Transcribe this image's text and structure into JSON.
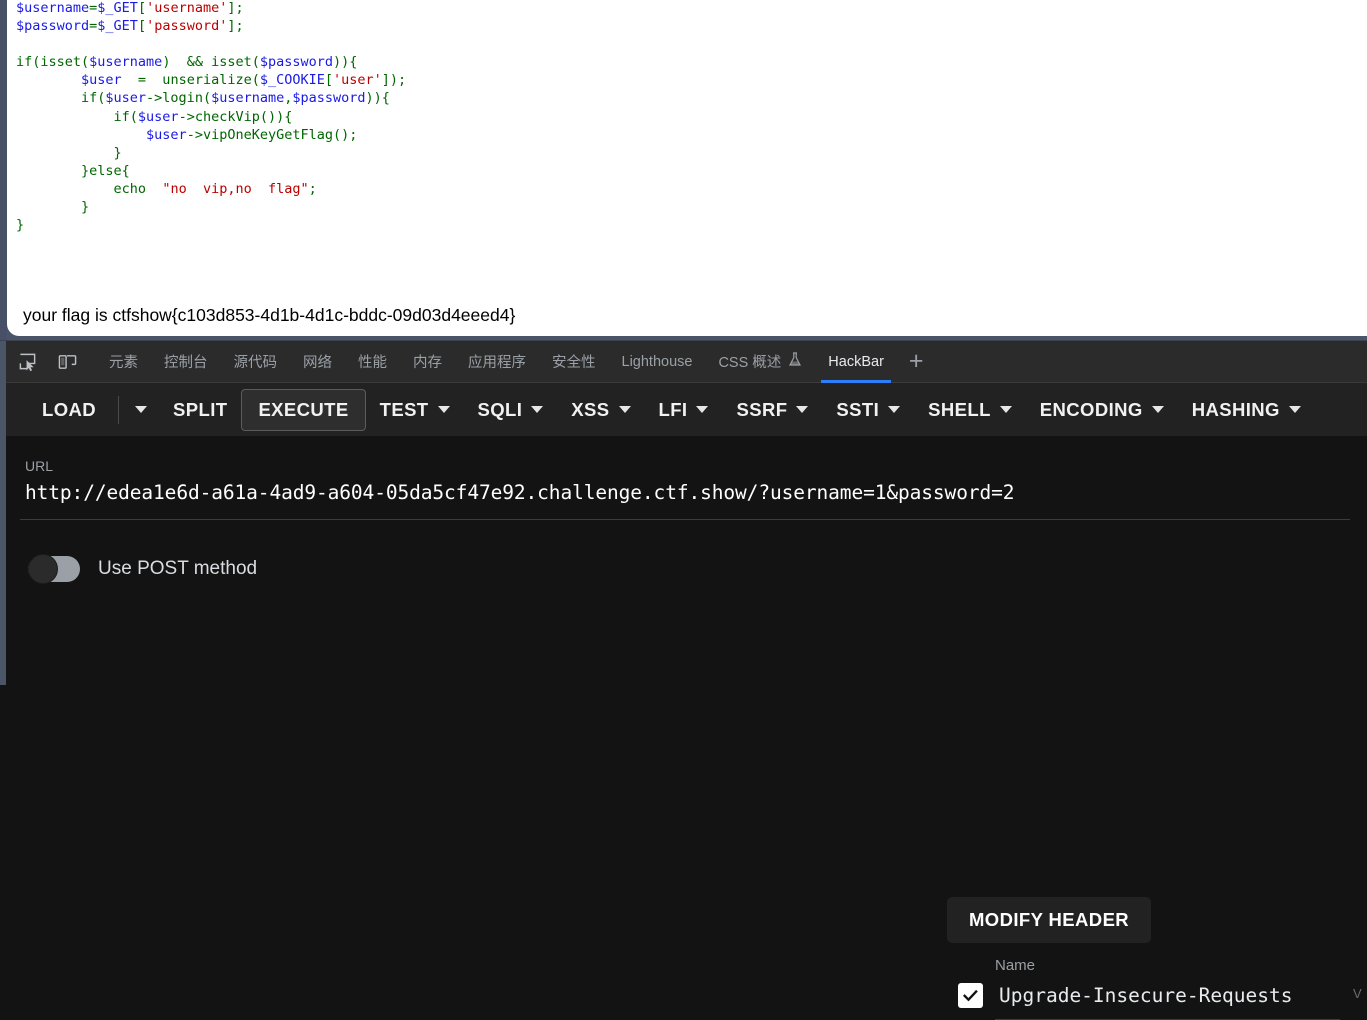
{
  "page": {
    "code_lines": [
      [
        {
          "t": "var",
          "s": "$username"
        },
        {
          "t": "pun",
          "s": "="
        },
        {
          "t": "var",
          "s": "$_GET"
        },
        {
          "t": "pun",
          "s": "["
        },
        {
          "t": "str",
          "s": "'username'"
        },
        {
          "t": "pun",
          "s": "];"
        }
      ],
      [
        {
          "t": "var",
          "s": "$password"
        },
        {
          "t": "pun",
          "s": "="
        },
        {
          "t": "var",
          "s": "$_GET"
        },
        {
          "t": "pun",
          "s": "["
        },
        {
          "t": "str",
          "s": "'password'"
        },
        {
          "t": "pun",
          "s": "];"
        }
      ],
      [],
      [
        {
          "t": "pun",
          "s": "if(isset("
        },
        {
          "t": "var",
          "s": "$username"
        },
        {
          "t": "pun",
          "s": ")  && isset("
        },
        {
          "t": "var",
          "s": "$password"
        },
        {
          "t": "pun",
          "s": ")){"
        }
      ],
      [
        {
          "t": "pun",
          "s": "        "
        },
        {
          "t": "var",
          "s": "$user"
        },
        {
          "t": "pun",
          "s": "  =  unserialize("
        },
        {
          "t": "var",
          "s": "$_COOKIE"
        },
        {
          "t": "pun",
          "s": "["
        },
        {
          "t": "str",
          "s": "'user'"
        },
        {
          "t": "pun",
          "s": "]);"
        }
      ],
      [
        {
          "t": "pun",
          "s": "        if("
        },
        {
          "t": "var",
          "s": "$user"
        },
        {
          "t": "pun",
          "s": "->login("
        },
        {
          "t": "var",
          "s": "$username"
        },
        {
          "t": "pun",
          "s": ","
        },
        {
          "t": "var",
          "s": "$password"
        },
        {
          "t": "pun",
          "s": ")){"
        }
      ],
      [
        {
          "t": "pun",
          "s": "            if("
        },
        {
          "t": "var",
          "s": "$user"
        },
        {
          "t": "pun",
          "s": "->checkVip()){"
        }
      ],
      [
        {
          "t": "pun",
          "s": "                "
        },
        {
          "t": "var",
          "s": "$user"
        },
        {
          "t": "pun",
          "s": "->vipOneKeyGetFlag();"
        }
      ],
      [
        {
          "t": "pun",
          "s": "            }"
        }
      ],
      [
        {
          "t": "pun",
          "s": "        }else{"
        }
      ],
      [
        {
          "t": "pun",
          "s": "            echo  "
        },
        {
          "t": "str",
          "s": "\"no  vip,no  flag\""
        },
        {
          "t": "pun",
          "s": ";"
        }
      ],
      [
        {
          "t": "pun",
          "s": "        }"
        }
      ],
      [
        {
          "t": "pun",
          "s": "}"
        }
      ]
    ],
    "flag_text": "your flag is ctfshow{c103d853-4d1b-4d1c-bddc-09d03d4eeed4}"
  },
  "devtools": {
    "icons": [
      {
        "name": "inspect-element-icon"
      },
      {
        "name": "device-toolbar-icon"
      }
    ],
    "tabs": [
      {
        "label": "元素",
        "active": false
      },
      {
        "label": "控制台",
        "active": false
      },
      {
        "label": "源代码",
        "active": false
      },
      {
        "label": "网络",
        "active": false
      },
      {
        "label": "性能",
        "active": false
      },
      {
        "label": "内存",
        "active": false
      },
      {
        "label": "应用程序",
        "active": false
      },
      {
        "label": "安全性",
        "active": false
      },
      {
        "label": "Lighthouse",
        "active": false
      },
      {
        "label": "CSS 概述",
        "active": false,
        "icon": "experiment-flask-icon"
      },
      {
        "label": "HackBar",
        "active": true
      }
    ],
    "add_tab_label": "+"
  },
  "hackbar": {
    "toolbar": [
      {
        "label": "LOAD",
        "caret": false,
        "boxed": false,
        "dropdown_split": true
      },
      {
        "label": "SPLIT",
        "caret": false,
        "boxed": false
      },
      {
        "label": "EXECUTE",
        "caret": false,
        "boxed": true
      },
      {
        "label": "TEST",
        "caret": true,
        "boxed": false
      },
      {
        "label": "SQLI",
        "caret": true,
        "boxed": false
      },
      {
        "label": "XSS",
        "caret": true,
        "boxed": false
      },
      {
        "label": "LFI",
        "caret": true,
        "boxed": false
      },
      {
        "label": "SSRF",
        "caret": true,
        "boxed": false
      },
      {
        "label": "SSTI",
        "caret": true,
        "boxed": false
      },
      {
        "label": "SHELL",
        "caret": true,
        "boxed": false
      },
      {
        "label": "ENCODING",
        "caret": true,
        "boxed": false
      },
      {
        "label": "HASHING",
        "caret": true,
        "boxed": false
      }
    ],
    "url_label": "URL",
    "url_value": "http://edea1e6d-a61a-4ad9-a604-05da5cf47e92.challenge.ctf.show/?username=1&password=2",
    "post_toggle_label": "Use POST method",
    "post_toggle_on": false,
    "modify_header_label": "MODIFY HEADER",
    "header_name_column": "Name",
    "header_value_column": "V",
    "header_rows": [
      {
        "checked": true,
        "name": "Upgrade-Insecure-Requests"
      }
    ]
  },
  "colors": {
    "accent": "#2d7ff9",
    "toolbar_bg": "#222222",
    "panel_bg": "#131313",
    "tabbar_bg": "#2b2b2b",
    "code_var": "#1a1ae6",
    "code_punct": "#006600",
    "code_string": "#bb0000"
  }
}
